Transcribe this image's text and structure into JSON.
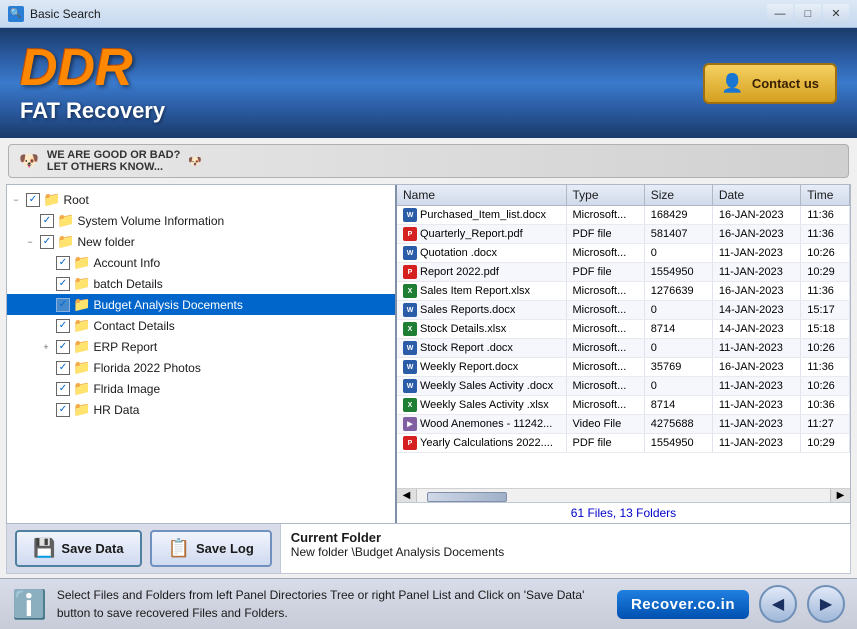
{
  "window": {
    "title": "Basic Search"
  },
  "header": {
    "logo": "DDR",
    "subtitle": "FAT Recovery",
    "contact_btn": "Contact us"
  },
  "review_banner": {
    "text1": "WE ARE GOOD OR BAD?",
    "text2": "LET OTHERS KNOW..."
  },
  "tree": {
    "items": [
      {
        "id": "root",
        "label": "Root",
        "level": 0,
        "checked": true,
        "expanded": true,
        "has_expand": true,
        "icon": "folder"
      },
      {
        "id": "sysvolinfo",
        "label": "System Volume Information",
        "level": 1,
        "checked": true,
        "expanded": false,
        "has_expand": false,
        "icon": "folder"
      },
      {
        "id": "newfolder",
        "label": "New folder",
        "level": 1,
        "checked": true,
        "expanded": true,
        "has_expand": true,
        "icon": "folder"
      },
      {
        "id": "accountinfo",
        "label": "Account Info",
        "level": 2,
        "checked": true,
        "expanded": false,
        "has_expand": false,
        "icon": "folder"
      },
      {
        "id": "batchdetails",
        "label": "batch Details",
        "level": 2,
        "checked": true,
        "expanded": false,
        "has_expand": false,
        "icon": "folder"
      },
      {
        "id": "budgetanalysis",
        "label": "Budget Analysis Docements",
        "level": 2,
        "checked": true,
        "expanded": false,
        "has_expand": false,
        "icon": "folder",
        "selected": true
      },
      {
        "id": "contactdetails",
        "label": "Contact Details",
        "level": 2,
        "checked": true,
        "expanded": false,
        "has_expand": false,
        "icon": "folder"
      },
      {
        "id": "erpreport",
        "label": "ERP Report",
        "level": 2,
        "checked": true,
        "expanded": true,
        "has_expand": true,
        "icon": "folder"
      },
      {
        "id": "florida2022",
        "label": "Florida 2022 Photos",
        "level": 2,
        "checked": true,
        "expanded": false,
        "has_expand": false,
        "icon": "folder"
      },
      {
        "id": "floridaimage",
        "label": "Flrida Image",
        "level": 2,
        "checked": true,
        "expanded": false,
        "has_expand": false,
        "icon": "folder"
      },
      {
        "id": "hrdata",
        "label": "HR Data",
        "level": 2,
        "checked": true,
        "expanded": false,
        "has_expand": false,
        "icon": "folder"
      }
    ]
  },
  "file_table": {
    "columns": [
      "Name",
      "Type",
      "Size",
      "Date",
      "Time"
    ],
    "files": [
      {
        "name": "Purchased_Item_list.docx",
        "type": "Microsoft...",
        "size": "168429",
        "date": "16-JAN-2023",
        "time": "11:36",
        "icon": "docx"
      },
      {
        "name": "Quarterly_Report.pdf",
        "type": "PDF file",
        "size": "581407",
        "date": "16-JAN-2023",
        "time": "11:36",
        "icon": "pdf"
      },
      {
        "name": "Quotation .docx",
        "type": "Microsoft...",
        "size": "0",
        "date": "11-JAN-2023",
        "time": "10:26",
        "icon": "docx"
      },
      {
        "name": "Report 2022.pdf",
        "type": "PDF file",
        "size": "1554950",
        "date": "11-JAN-2023",
        "time": "10:29",
        "icon": "pdf"
      },
      {
        "name": "Sales Item Report.xlsx",
        "type": "Microsoft...",
        "size": "1276639",
        "date": "16-JAN-2023",
        "time": "11:36",
        "icon": "xlsx"
      },
      {
        "name": "Sales Reports.docx",
        "type": "Microsoft...",
        "size": "0",
        "date": "14-JAN-2023",
        "time": "15:17",
        "icon": "docx"
      },
      {
        "name": "Stock Details.xlsx",
        "type": "Microsoft...",
        "size": "8714",
        "date": "14-JAN-2023",
        "time": "15:18",
        "icon": "xlsx"
      },
      {
        "name": "Stock Report .docx",
        "type": "Microsoft...",
        "size": "0",
        "date": "11-JAN-2023",
        "time": "10:26",
        "icon": "docx"
      },
      {
        "name": "Weekly Report.docx",
        "type": "Microsoft...",
        "size": "35769",
        "date": "16-JAN-2023",
        "time": "11:36",
        "icon": "docx"
      },
      {
        "name": "Weekly Sales Activity .docx",
        "type": "Microsoft...",
        "size": "0",
        "date": "11-JAN-2023",
        "time": "10:26",
        "icon": "docx"
      },
      {
        "name": "Weekly Sales Activity .xlsx",
        "type": "Microsoft...",
        "size": "8714",
        "date": "11-JAN-2023",
        "time": "10:36",
        "icon": "xlsx"
      },
      {
        "name": "Wood Anemones - 11242...",
        "type": "Video File",
        "size": "4275688",
        "date": "11-JAN-2023",
        "time": "11:27",
        "icon": "video"
      },
      {
        "name": "Yearly Calculations 2022....",
        "type": "PDF file",
        "size": "1554950",
        "date": "11-JAN-2023",
        "time": "10:29",
        "icon": "pdf"
      }
    ]
  },
  "file_count": "61 Files, 13 Folders",
  "current_folder": {
    "title": "Current Folder",
    "path": "New folder \\Budget Analysis Docements"
  },
  "toolbar": {
    "save_data": "Save Data",
    "save_log": "Save Log"
  },
  "status_bar": {
    "text": "Select Files and Folders from left Panel Directories Tree or right Panel List and Click on 'Save Data' button to save recovered Files and Folders.",
    "brand": "Recover.co.in"
  },
  "titlebar_controls": {
    "minimize": "—",
    "maximize": "□",
    "close": "✕"
  }
}
